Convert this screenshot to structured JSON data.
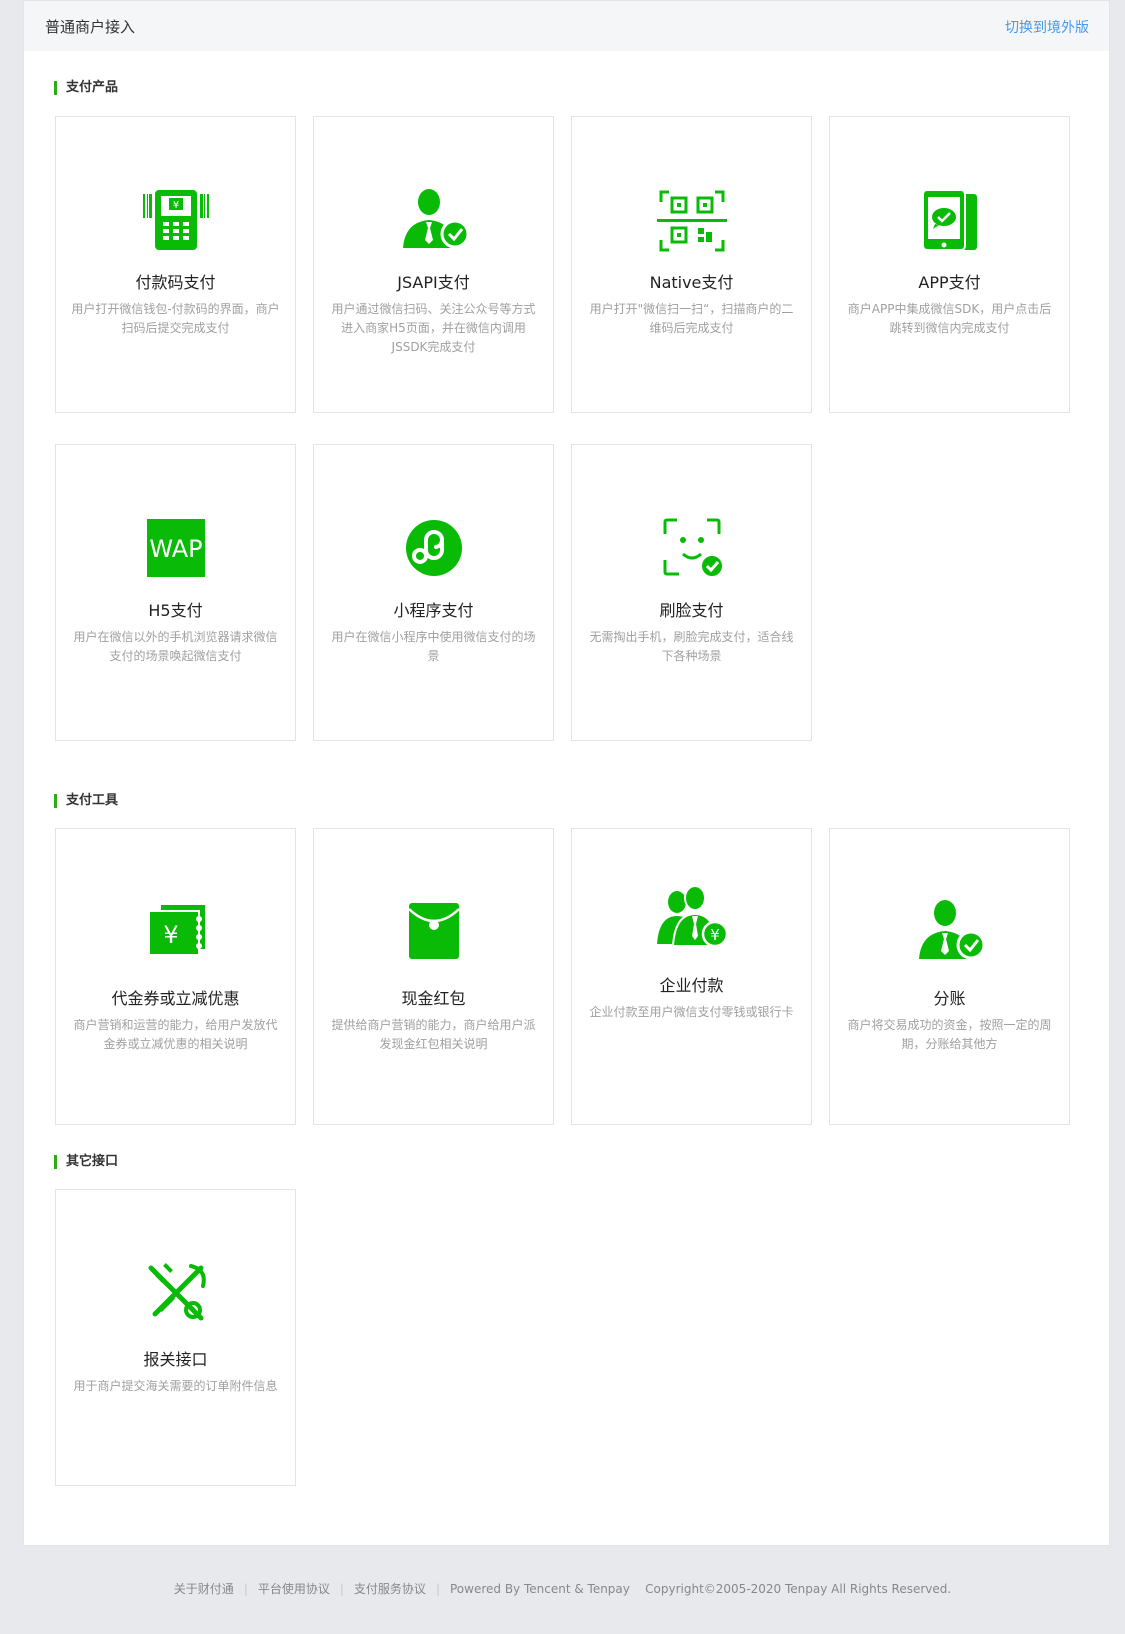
{
  "header": {
    "title": "普通商户接入",
    "switch_label": "切换到境外版"
  },
  "sections": {
    "payment_products": "支付产品",
    "payment_tools": "支付工具",
    "other_apis": "其它接口"
  },
  "products": [
    {
      "name": "付款码支付",
      "icon": "payment-code-terminal-icon",
      "desc": "用户打开微信钱包-付款码的界面，商户扫码后提交完成支付"
    },
    {
      "name": "JSAPI支付",
      "icon": "user-check-icon",
      "desc": "用户通过微信扫码、关注公众号等方式进入商家H5页面，并在微信内调用JSSDK完成支付"
    },
    {
      "name": "Native支付",
      "icon": "qr-scan-icon",
      "desc": "用户打开\"微信扫一扫“，扫描商户的二维码后完成支付"
    },
    {
      "name": "APP支付",
      "icon": "mobile-app-icon",
      "desc": "商户APP中集成微信SDK，用户点击后跳转到微信内完成支付"
    },
    {
      "name": "H5支付",
      "icon": "wap-icon",
      "icon_text": "WAP",
      "desc": "用户在微信以外的手机浏览器请求微信支付的场景唤起微信支付"
    },
    {
      "name": "小程序支付",
      "icon": "mini-program-icon",
      "desc": "用户在微信小程序中使用微信支付的场景"
    },
    {
      "name": "刷脸支付",
      "icon": "face-pay-icon",
      "desc": "无需掏出手机，刷脸完成支付，适合线下各种场景"
    }
  ],
  "tools": [
    {
      "name": "代金券或立减优惠",
      "icon": "coupon-icon",
      "desc": "商户营销和运营的能力，给用户发放代金券或立减优惠的相关说明"
    },
    {
      "name": "现金红包",
      "icon": "red-packet-icon",
      "desc": "提供给商户营销的能力，商户给用户派发现金红包相关说明"
    },
    {
      "name": "企业付款",
      "icon": "enterprise-payment-icon",
      "desc": "企业付款至用户微信支付零钱或银行卡"
    },
    {
      "name": "分账",
      "icon": "profit-sharing-icon",
      "desc": "商户将交易成功的资金，按照一定的周期，分账给其他方"
    }
  ],
  "others": [
    {
      "name": "报关接口",
      "icon": "customs-declaration-icon",
      "desc": "用于商户提交海关需要的订单附件信息"
    }
  ],
  "footer": {
    "about": "关于财付通",
    "platform_agreement": "平台使用协议",
    "service_agreement": "支付服务协议",
    "powered": "Powered By Tencent & Tenpay",
    "copyright": "Copyright©2005-2020 Tenpay All Rights Reserved."
  },
  "colors": {
    "accent": "#09bb07",
    "link": "#459ae9",
    "section_bar": "#2bad13"
  }
}
